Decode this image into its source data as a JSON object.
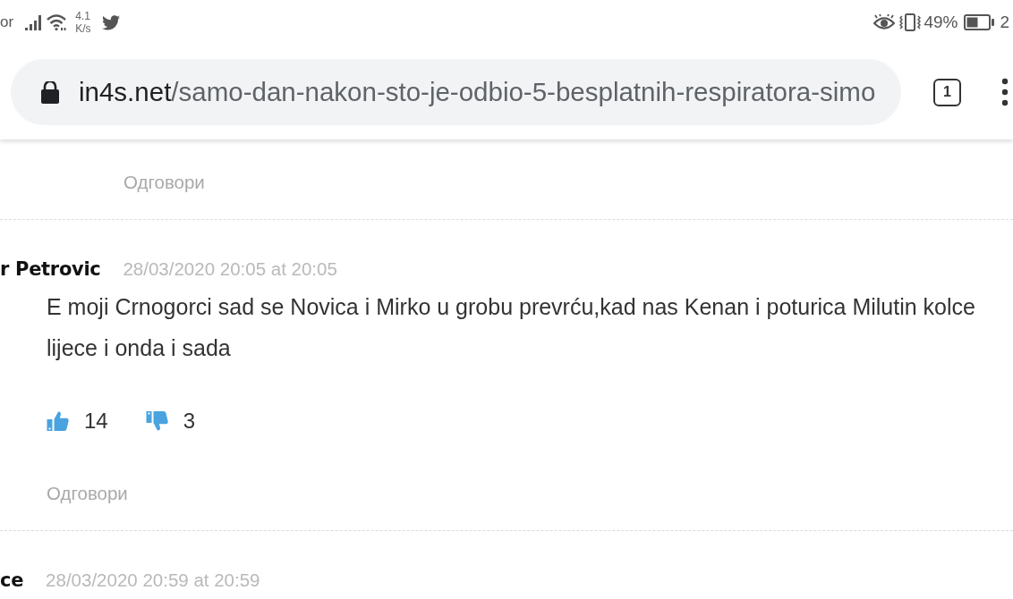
{
  "status_bar": {
    "carrier": "or",
    "network_speed": {
      "value": "4.1",
      "unit": "K/s"
    },
    "battery_percent": "49%",
    "time": "2"
  },
  "address_bar": {
    "domain": "in4s.net",
    "path": "/samo-dan-nakon-sto-je-odbio-5-besplatnih-respiratora-simo",
    "tab_count": "1"
  },
  "comments": [
    {
      "kind": "reply",
      "reply_link": "Одговори"
    },
    {
      "kind": "comment",
      "author": "r Petrovic",
      "date": "28/03/2020 20:05 at 20:05",
      "text_lines": [
        "E moji Crnogorci sad se Novica i Mirko u grobu prevrću,kad nas Kenan i poturica Milutin kolce",
        "lijece i onda i sada"
      ],
      "likes": "14",
      "dislikes": "3",
      "reply_link": "Одговори"
    },
    {
      "kind": "comment",
      "author": "ce",
      "date": "28/03/2020 20:59 at 20:59"
    }
  ]
}
